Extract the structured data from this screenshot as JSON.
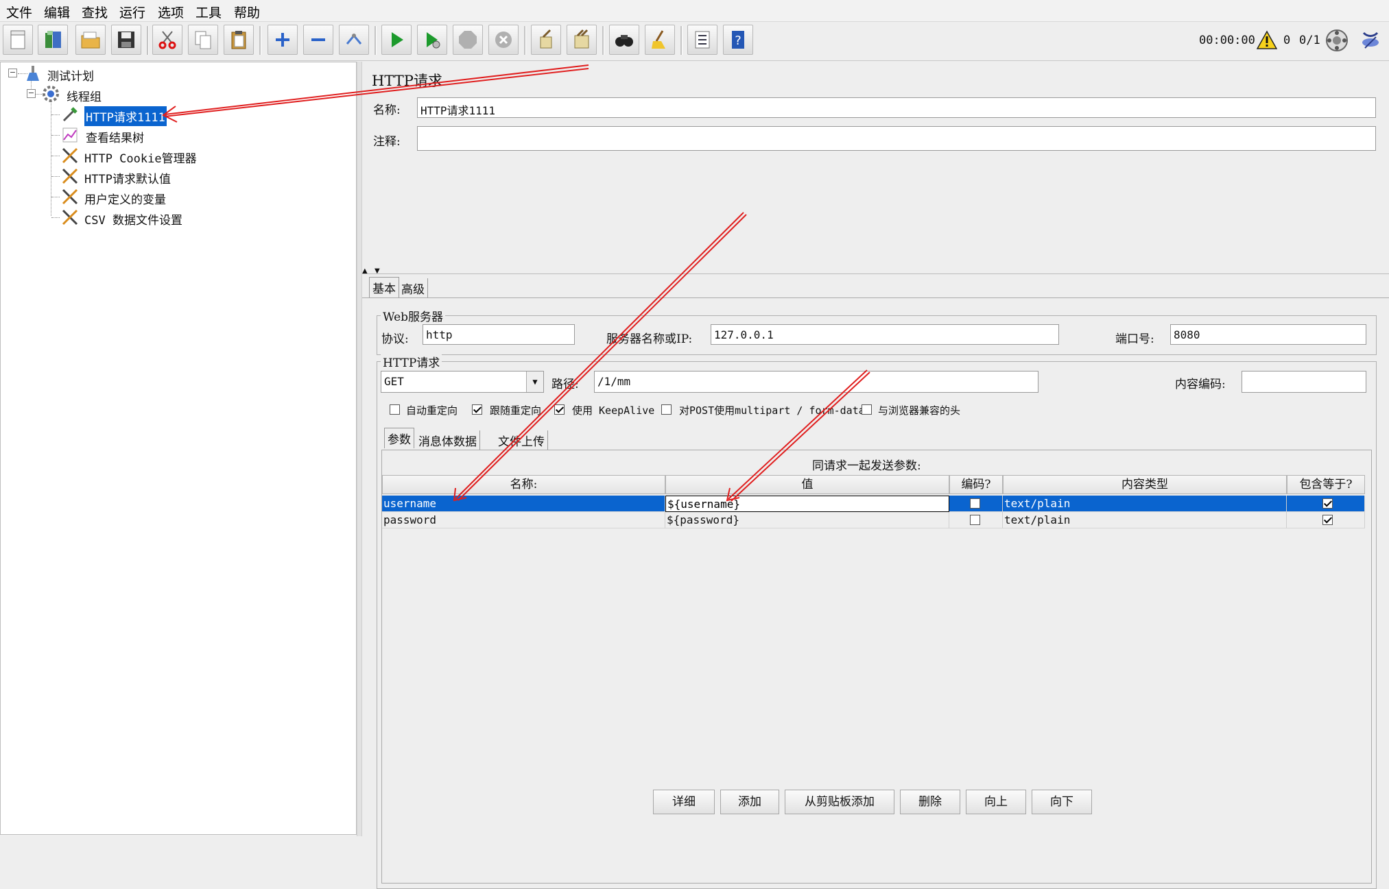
{
  "menu": [
    "文件",
    "编辑",
    "查找",
    "运行",
    "选项",
    "工具",
    "帮助"
  ],
  "toolbar": {
    "buttons": [
      "new-icon",
      "templates-icon",
      "open-icon",
      "save-icon",
      "cut-icon",
      "copy-icon",
      "paste-icon",
      "expand-icon",
      "collapse-icon",
      "toggle-icon",
      "start-icon",
      "start-no-pause-icon",
      "stop-icon",
      "shutdown-icon",
      "clear-icon",
      "clear-all-icon",
      "search-icon",
      "reset-search-icon",
      "function-helper-icon",
      "help-icon"
    ],
    "timer": "00:00:00",
    "warning_count": "0",
    "threads": "0/1"
  },
  "tree": {
    "root": "测试计划",
    "thread_group": "线程组",
    "items": [
      "HTTP请求1111",
      "查看结果树",
      "HTTP Cookie管理器",
      "HTTP请求默认值",
      "用户定义的变量",
      "CSV 数据文件设置"
    ],
    "selected_index": 0
  },
  "panel": {
    "title": "HTTP请求",
    "name_label": "名称:",
    "name_value": "HTTP请求1111",
    "comment_label": "注释:",
    "comment_value": "",
    "tabs": [
      "基本",
      "高级"
    ],
    "web_server": {
      "title": "Web服务器",
      "protocol_label": "协议:",
      "protocol_value": "http",
      "server_label": "服务器名称或IP:",
      "server_value": "127.0.0.1",
      "port_label": "端口号:",
      "port_value": "8080"
    },
    "http_request": {
      "title": "HTTP请求",
      "method": "GET",
      "path_label": "路径:",
      "path_value": "/1/mm",
      "encoding_label": "内容编码:",
      "encoding_value": ""
    },
    "options": [
      {
        "label": "自动重定向",
        "checked": false
      },
      {
        "label": "跟随重定向",
        "checked": true
      },
      {
        "label": "使用 KeepAlive",
        "checked": true
      },
      {
        "label": "对POST使用multipart / form-data",
        "checked": false
      },
      {
        "label": "与浏览器兼容的头",
        "checked": false
      }
    ],
    "sub_tabs": [
      "参数",
      "消息体数据",
      "文件上传"
    ],
    "params_caption": "同请求一起发送参数:",
    "columns": [
      "名称:",
      "值",
      "编码?",
      "内容类型",
      "包含等于?"
    ],
    "rows": [
      {
        "name": "username",
        "value": "${username}",
        "encode": false,
        "content_type": "text/plain",
        "include_equals": true
      },
      {
        "name": "password",
        "value": "${password}",
        "encode": false,
        "content_type": "text/plain",
        "include_equals": true
      }
    ],
    "buttons": [
      "详细",
      "添加",
      "从剪贴板添加",
      "删除",
      "向上",
      "向下"
    ]
  },
  "colors": {
    "selection": "#0a64cf",
    "annotation_arrow": "#e01e1e"
  }
}
